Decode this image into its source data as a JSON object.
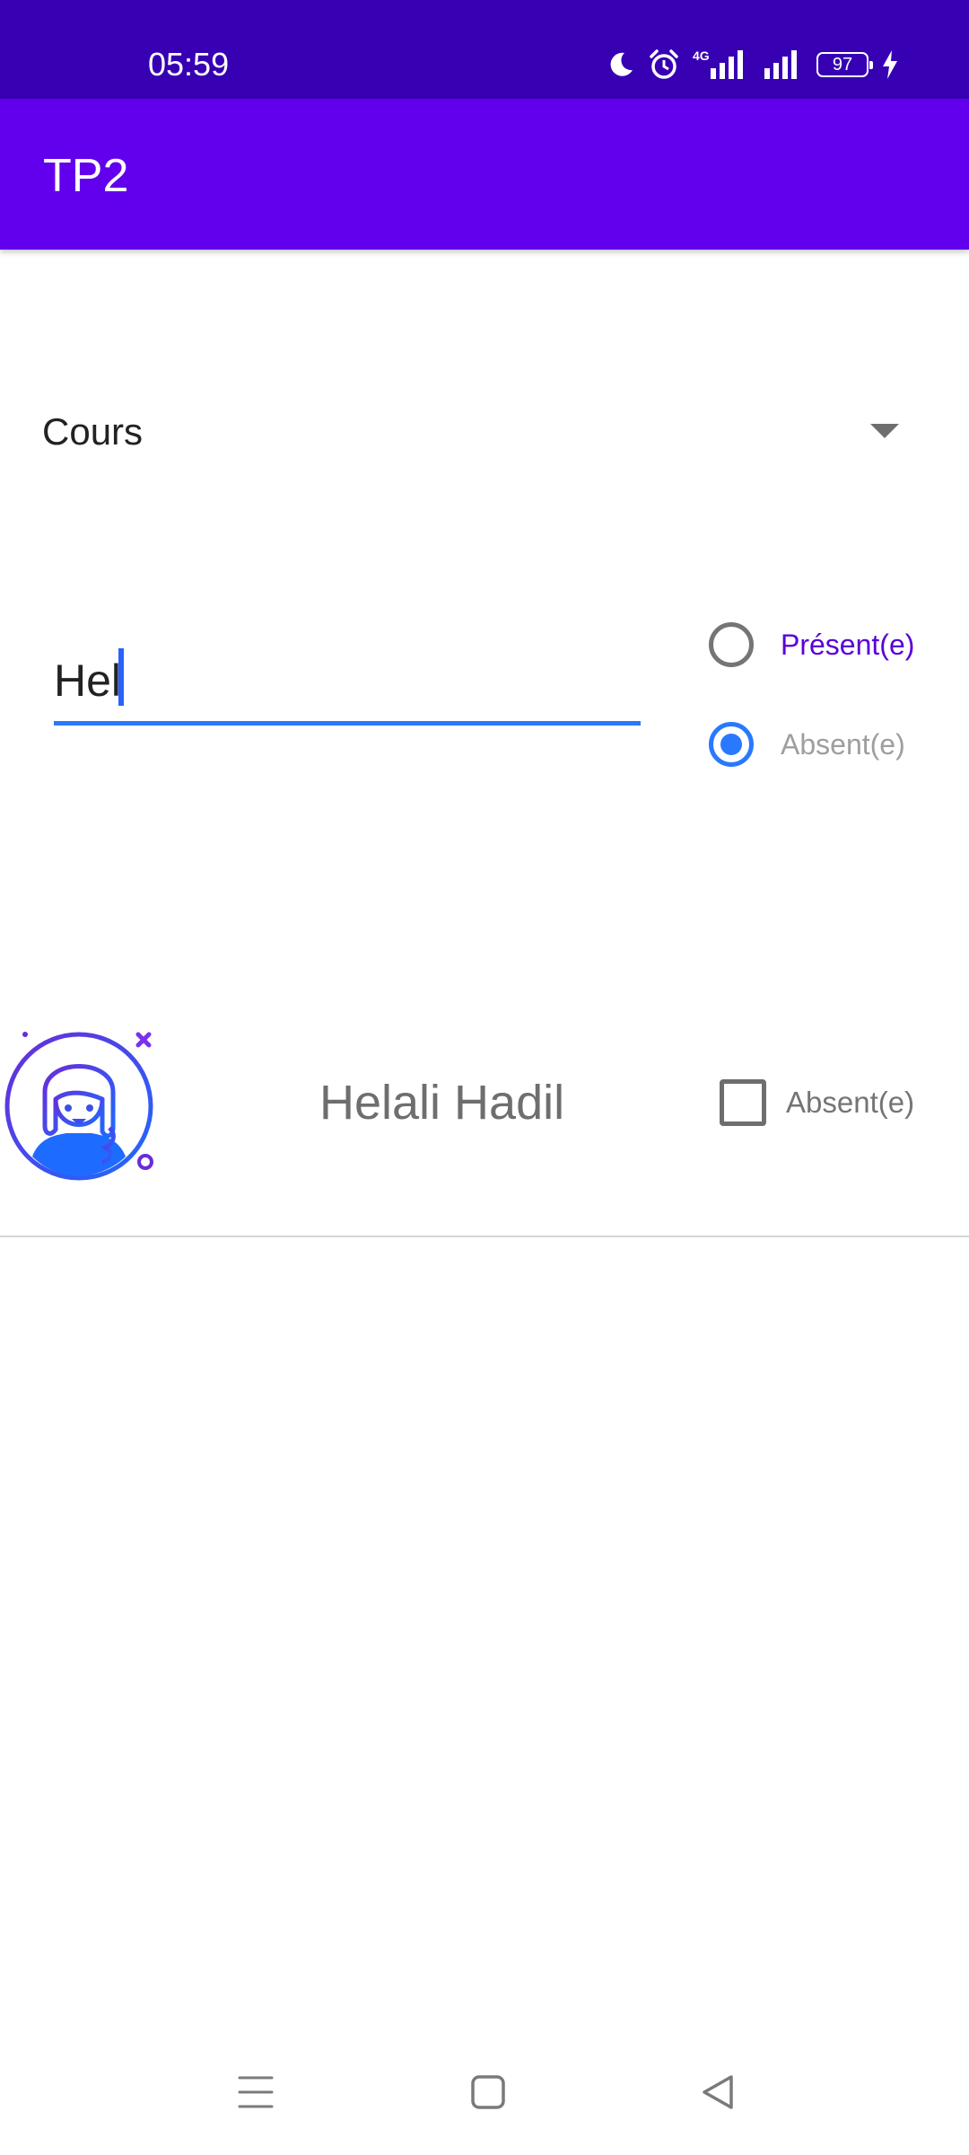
{
  "status_bar": {
    "time": "05:59",
    "icons": [
      "moon-icon",
      "alarm-icon",
      "signal-4g-icon",
      "signal-icon",
      "battery-icon",
      "charging-icon"
    ],
    "network_label": "4G",
    "battery_level": "97"
  },
  "app_bar": {
    "title": "TP2"
  },
  "course_spinner": {
    "selected": "Cours"
  },
  "search": {
    "value": "Hel"
  },
  "attendance_filter": {
    "options": [
      {
        "label": "Présent(e)",
        "checked": false
      },
      {
        "label": "Absent(e)",
        "checked": true
      }
    ]
  },
  "students": [
    {
      "name": "Helali Hadil",
      "checkbox_label": "Absent(e)",
      "checked": false
    }
  ],
  "nav_bar": {
    "icons": [
      "menu-icon",
      "home-square-icon",
      "back-triangle-icon"
    ]
  },
  "colors": {
    "status_bar": "#3700B3",
    "app_bar": "#6200EE",
    "accent": "#2979FF",
    "selected_label": "#5800D8"
  }
}
